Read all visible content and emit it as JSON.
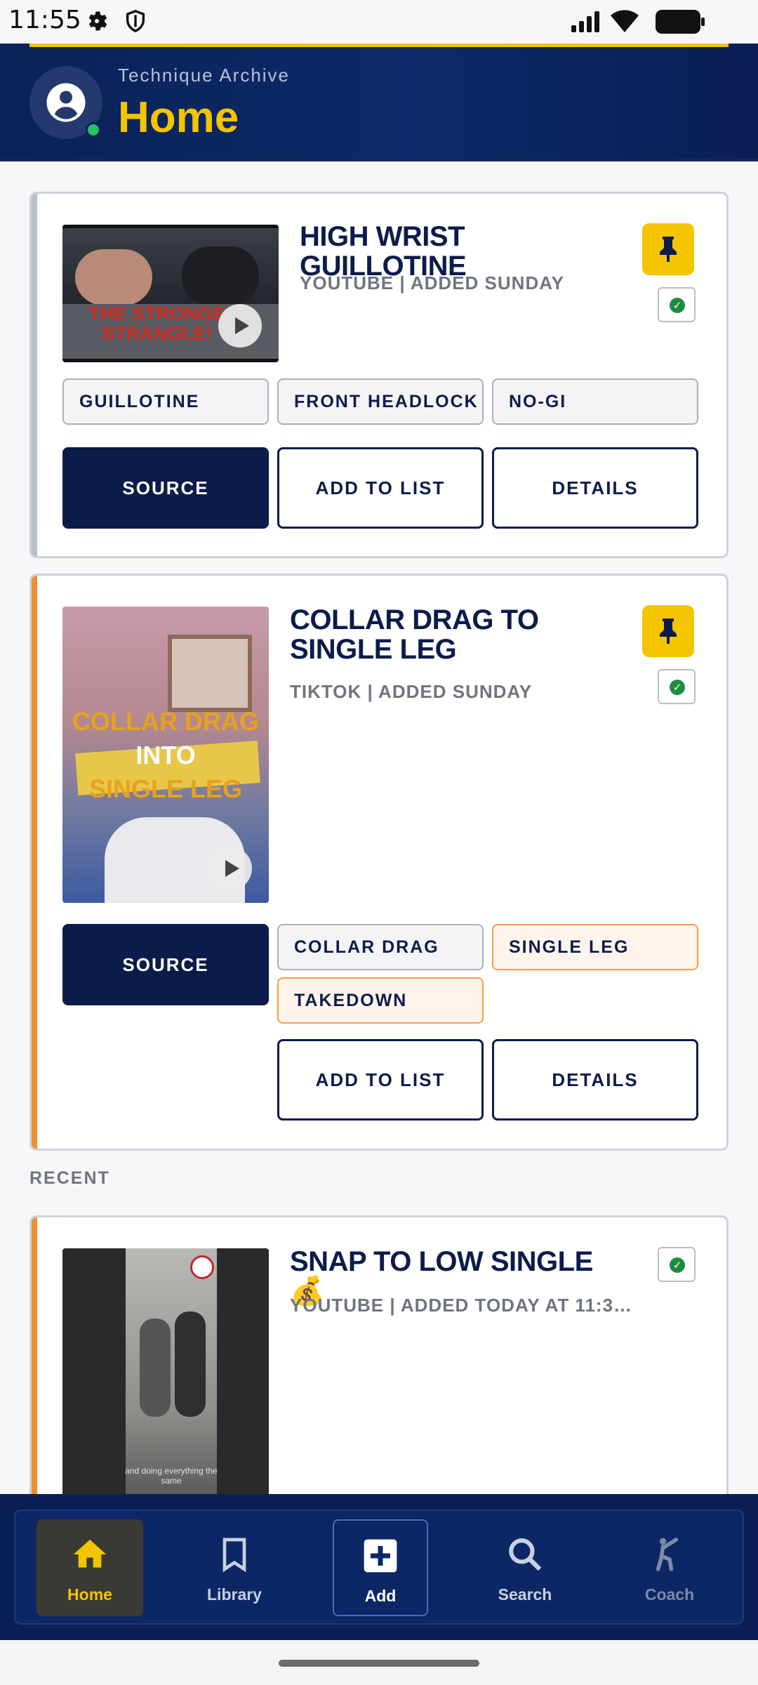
{
  "status": {
    "time": "11:55"
  },
  "header": {
    "subtitle": "Technique Archive",
    "title": "Home"
  },
  "cards": [
    {
      "title": "HIGH WRIST GUILLOTINE",
      "meta": "YOUTUBE | ADDED SUNDAY",
      "thumb_text": "THE STRONGE STRANGLE!",
      "tags": [
        "GUILLOTINE",
        "FRONT HEADLOCK",
        "NO-GI"
      ],
      "buttons": {
        "source": "SOURCE",
        "add": "ADD TO LIST",
        "details": "DETAILS"
      },
      "stripe_color": "#b9c0cc"
    },
    {
      "title": "COLLAR DRAG TO SINGLE LEG",
      "meta": "TIKTOK | ADDED SUNDAY",
      "thumb_text": [
        "COLLAR DRAG",
        "INTO",
        "SINGLE LEG"
      ],
      "tags": [
        "COLLAR DRAG",
        "SINGLE LEG",
        "TAKEDOWN"
      ],
      "buttons": {
        "source": "SOURCE",
        "add": "ADD TO LIST",
        "details": "DETAILS"
      },
      "stripe_color": "#f0902e"
    },
    {
      "title": "SNAP TO LOW SINGLE 💰",
      "meta": "YOUTUBE | ADDED TODAY AT 11:3…",
      "thumb_text": "and doing everything the same",
      "stripe_color": "#f0902e"
    }
  ],
  "recent_label": "RECENT",
  "nav": [
    {
      "label": "Home",
      "icon": "home-icon",
      "active": true
    },
    {
      "label": "Library",
      "icon": "bookmark-icon"
    },
    {
      "label": "Add",
      "icon": "plus-icon"
    },
    {
      "label": "Search",
      "icon": "search-icon"
    },
    {
      "label": "Coach",
      "icon": "kick-icon"
    }
  ],
  "colors": {
    "navy": "#0c1c4a",
    "gold": "#f5c400",
    "orange": "#f0902e"
  }
}
